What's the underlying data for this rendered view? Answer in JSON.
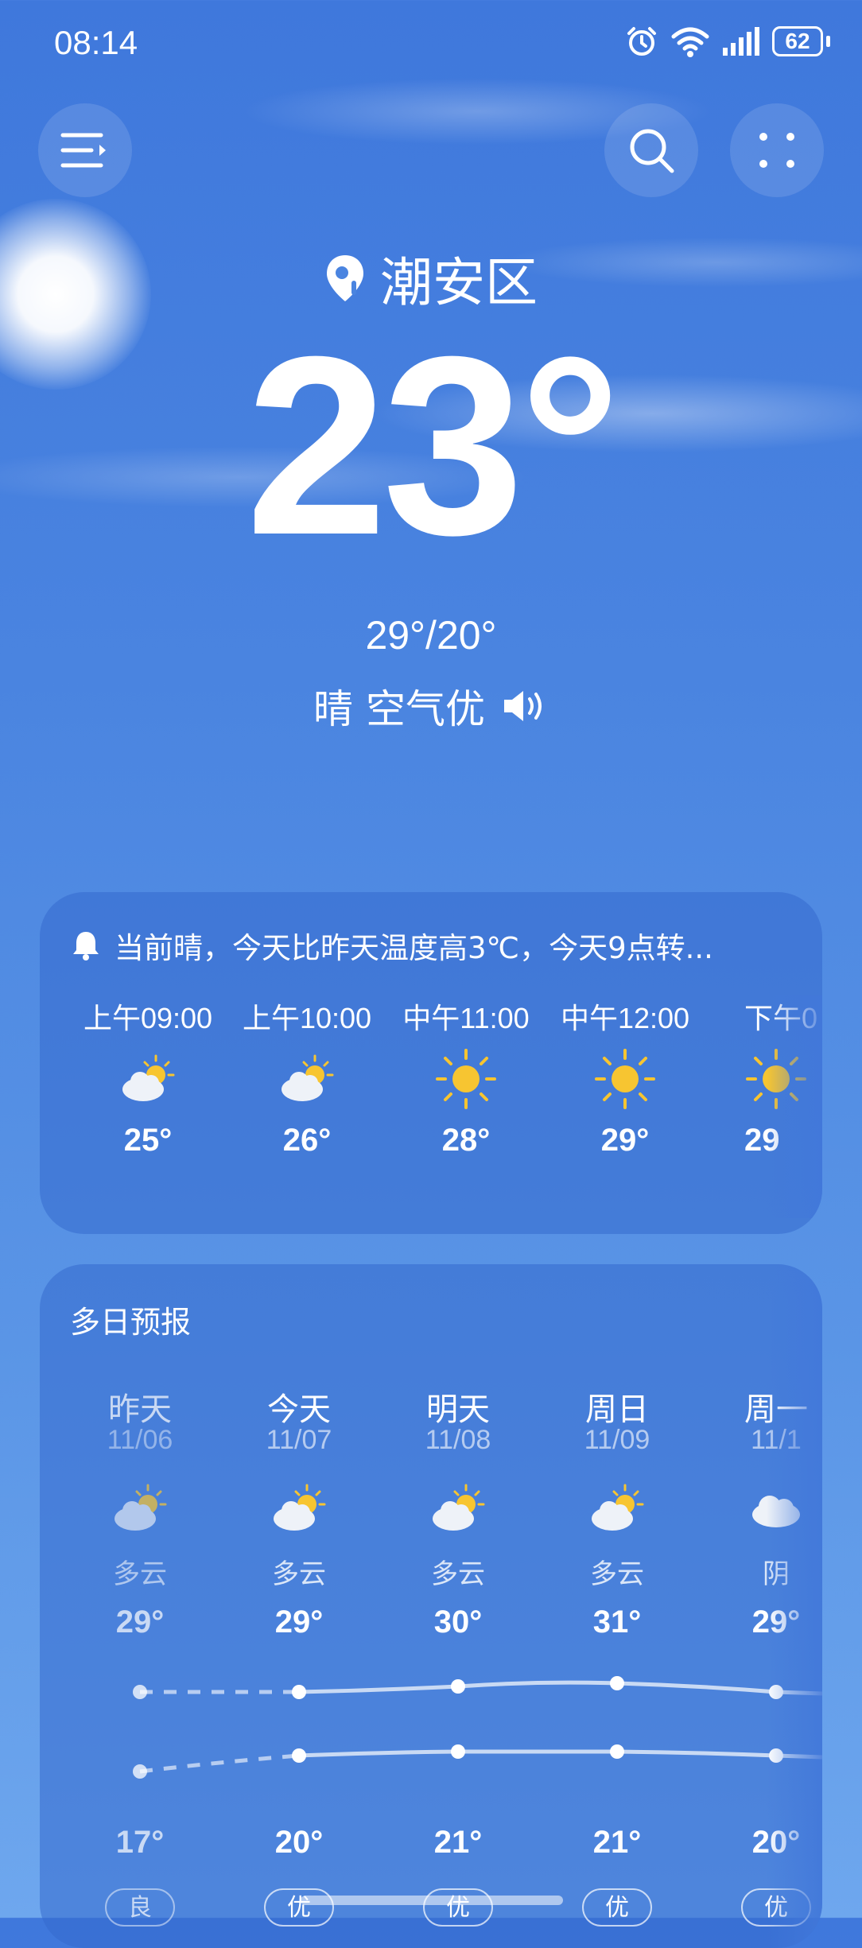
{
  "status": {
    "time": "08:14",
    "battery": "62"
  },
  "location": "潮安区",
  "current": {
    "temp": "23°",
    "hilo": "29°/20°",
    "condition": "晴 空气优"
  },
  "alert": "当前晴，今天比昨天温度高3℃，今天9点转...",
  "hourly": [
    {
      "time": "上午09:00",
      "temp": "25°",
      "icon": "partly-cloudy-icon"
    },
    {
      "time": "上午10:00",
      "temp": "26°",
      "icon": "partly-cloudy-icon"
    },
    {
      "time": "中午11:00",
      "temp": "28°",
      "icon": "sunny-icon"
    },
    {
      "time": "中午12:00",
      "temp": "29°",
      "icon": "sunny-icon"
    },
    {
      "time": "下午0",
      "temp": "29",
      "icon": "sunny-icon"
    }
  ],
  "daily_title": "多日预报",
  "daily": [
    {
      "day": "昨天",
      "date": "11/06",
      "cond": "多云",
      "high": "29°",
      "low": "17°",
      "aqi": "良",
      "icon": "partly-cloudy-icon"
    },
    {
      "day": "今天",
      "date": "11/07",
      "cond": "多云",
      "high": "29°",
      "low": "20°",
      "aqi": "优",
      "icon": "partly-cloudy-icon"
    },
    {
      "day": "明天",
      "date": "11/08",
      "cond": "多云",
      "high": "30°",
      "low": "21°",
      "aqi": "优",
      "icon": "partly-cloudy-icon"
    },
    {
      "day": "周日",
      "date": "11/09",
      "cond": "多云",
      "high": "31°",
      "low": "21°",
      "aqi": "优",
      "icon": "partly-cloudy-icon"
    },
    {
      "day": "周一",
      "date": "11/1",
      "cond": "阴",
      "high": "29°",
      "low": "20°",
      "aqi": "优",
      "icon": "cloudy-icon"
    }
  ],
  "colors": {
    "background": "#4a84e0",
    "card": "#346ace",
    "sun": "#f7c531"
  }
}
